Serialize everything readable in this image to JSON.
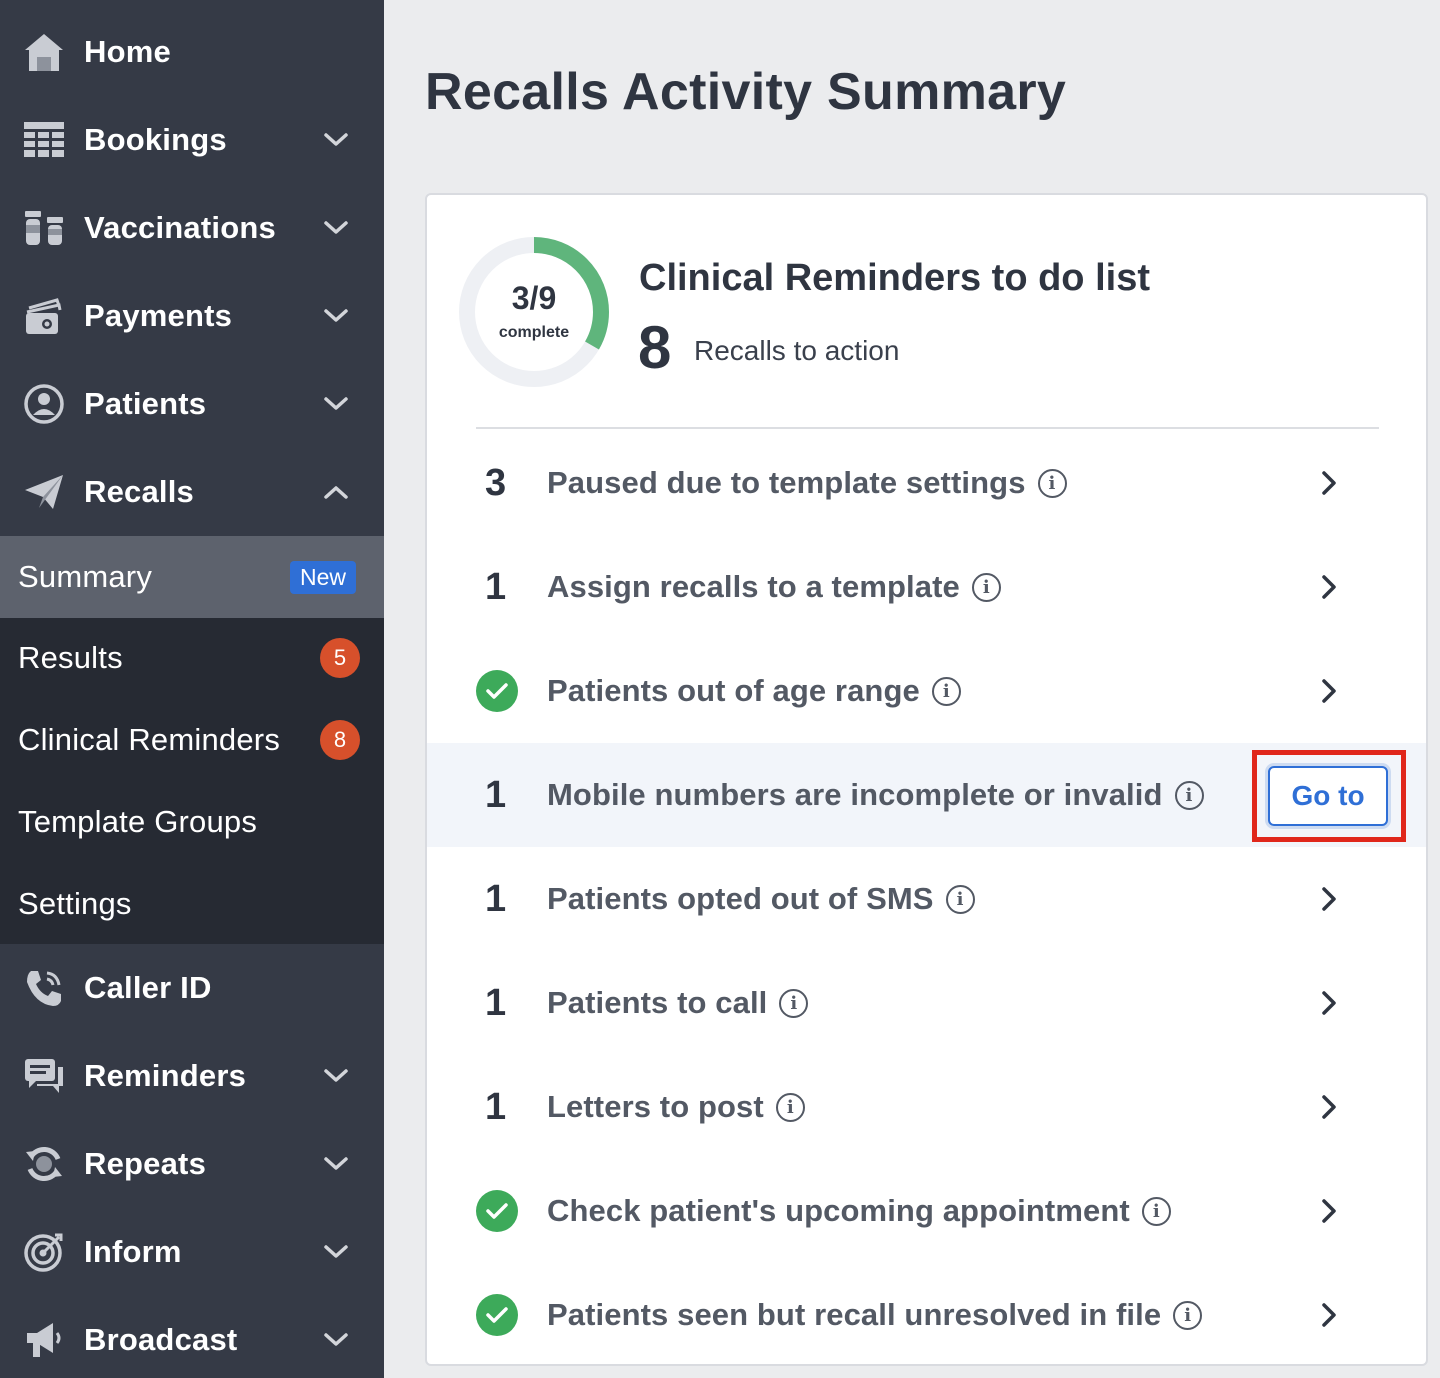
{
  "sidebar": {
    "items": [
      {
        "label": "Home",
        "icon": "home-icon"
      },
      {
        "label": "Bookings",
        "icon": "calendar-grid-icon"
      },
      {
        "label": "Vaccinations",
        "icon": "vials-icon"
      },
      {
        "label": "Payments",
        "icon": "wallet-icon"
      },
      {
        "label": "Patients",
        "icon": "user-circle-icon"
      },
      {
        "label": "Recalls",
        "icon": "paper-plane-icon"
      },
      {
        "label": "Caller ID",
        "icon": "phone-icon"
      },
      {
        "label": "Reminders",
        "icon": "chat-icon"
      },
      {
        "label": "Repeats",
        "icon": "refresh-icon"
      },
      {
        "label": "Inform",
        "icon": "target-icon"
      },
      {
        "label": "Broadcast",
        "icon": "megaphone-icon"
      }
    ],
    "recalls_sub": {
      "summary": "Summary",
      "summary_badge": "New",
      "results": "Results",
      "results_count": "5",
      "clinical_reminders": "Clinical Reminders",
      "clinical_reminders_count": "8",
      "template_groups": "Template Groups",
      "settings": "Settings"
    }
  },
  "main": {
    "title": "Recalls Activity Summary",
    "card": {
      "progress": {
        "fraction": "3/9",
        "label": "complete",
        "completed": 3,
        "total": 9
      },
      "todo_title": "Clinical Reminders to do list",
      "todo_count": "8",
      "todo_count_label": "Recalls to action",
      "rows": [
        {
          "count": "3",
          "text": "Paused due to template settings",
          "done": false
        },
        {
          "count": "1",
          "text": "Assign recalls to a template",
          "done": false
        },
        {
          "count": "",
          "text": "Patients out of age range",
          "done": true
        },
        {
          "count": "1",
          "text": "Mobile numbers are incomplete or invalid",
          "done": false,
          "action": "Go to"
        },
        {
          "count": "1",
          "text": "Patients opted out of SMS",
          "done": false
        },
        {
          "count": "1",
          "text": "Patients to call",
          "done": false
        },
        {
          "count": "1",
          "text": "Letters to post",
          "done": false
        },
        {
          "count": "",
          "text": "Check patient's upcoming appointment",
          "done": true
        },
        {
          "count": "",
          "text": "Patients seen but recall unresolved in file",
          "done": true
        }
      ]
    }
  },
  "colors": {
    "sidebar_bg": "#353a46",
    "subnav_bg": "#262a33",
    "active_bg": "#5d626d",
    "accent": "#2f6fd6",
    "badge": "#d7502b",
    "success": "#3daa5a",
    "highlight_frame": "#e0271b"
  }
}
